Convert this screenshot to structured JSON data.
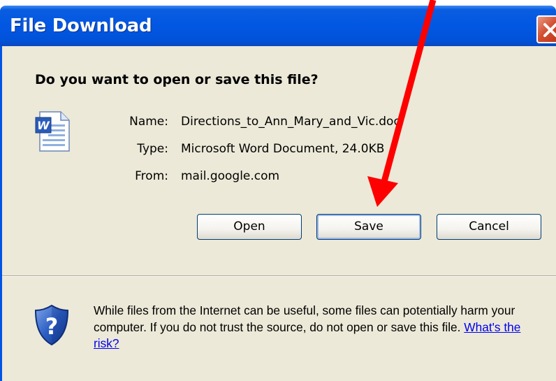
{
  "dialog": {
    "title": "File Download",
    "question": "Do you want to open or save this file?"
  },
  "file": {
    "name_label": "Name:",
    "name_value": "Directions_to_Ann_Mary_and_Vic.doc",
    "type_label": "Type:",
    "type_value": "Microsoft Word Document, 24.0KB",
    "from_label": "From:",
    "from_value": "mail.google.com"
  },
  "buttons": {
    "open": "Open",
    "save": "Save",
    "cancel": "Cancel"
  },
  "warning": {
    "text": "While files from the Internet can be useful, some files can potentially harm your computer. If you do not trust the source, do not open or save this file.",
    "link": "What's the risk?"
  },
  "icons": {
    "file": "word-document-icon",
    "security": "shield-question-icon",
    "close": "close-icon",
    "annotation": "red-arrow-icon"
  },
  "colors": {
    "titlebar": "#0054e3",
    "dialog_bg": "#ece9d8",
    "close_button": "#d24f31",
    "annotation_arrow": "#ff0000",
    "link": "#0000ee"
  }
}
